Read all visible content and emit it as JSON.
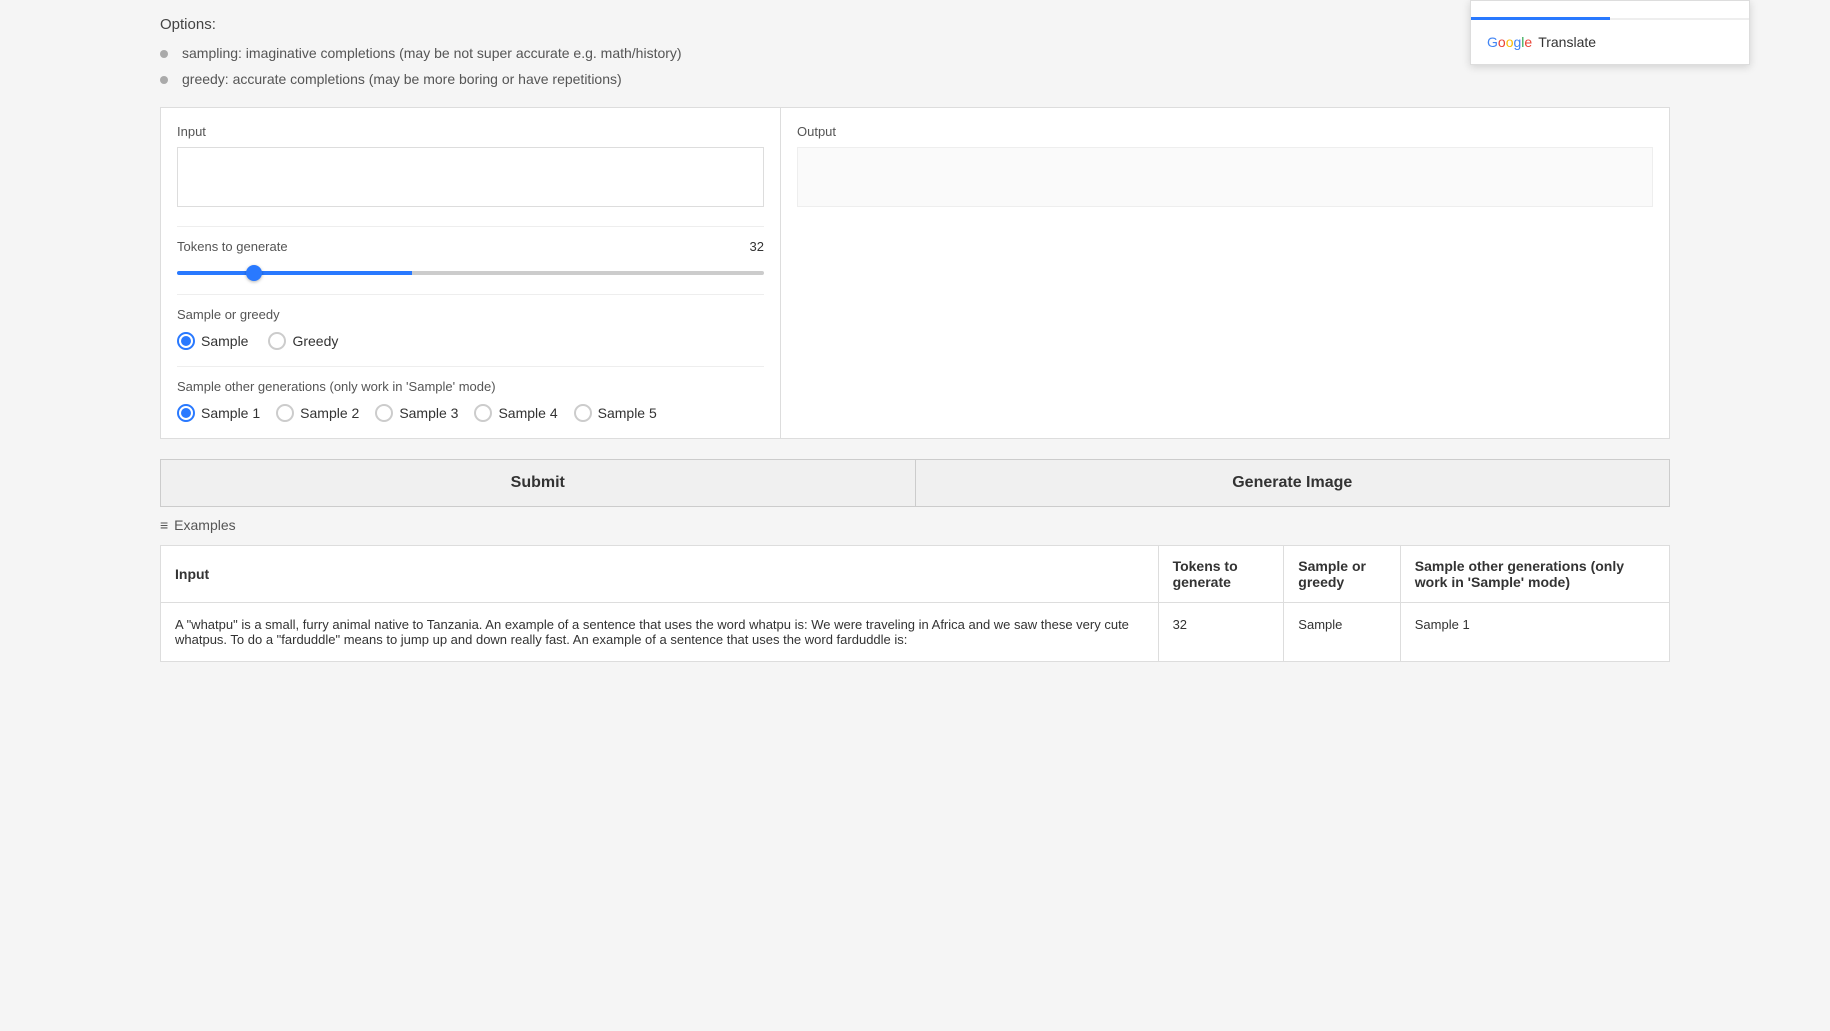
{
  "options": {
    "heading": "Options:",
    "bullets": [
      "sampling: imaginative completions (may be not super accurate e.g. math/history)",
      "greedy: accurate completions (may be more boring or have repetitions)"
    ]
  },
  "input_panel": {
    "label": "Input",
    "placeholder": ""
  },
  "output_panel": {
    "label": "Output"
  },
  "tokens": {
    "label": "Tokens to generate",
    "value": "32",
    "slider_percent": 40
  },
  "sample_greedy": {
    "label": "Sample or greedy",
    "options": [
      "Sample",
      "Greedy"
    ],
    "selected": "Sample"
  },
  "sample_generations": {
    "label": "Sample other generations (only work in 'Sample' mode)",
    "options": [
      "Sample 1",
      "Sample 2",
      "Sample 3",
      "Sample 4",
      "Sample 5"
    ],
    "selected": "Sample 1"
  },
  "buttons": {
    "submit": "Submit",
    "generate_image": "Generate Image"
  },
  "examples": {
    "heading": "Examples",
    "columns": [
      "Input",
      "Tokens to generate",
      "Sample or greedy",
      "Sample other generations (only work in 'Sample' mode)"
    ],
    "rows": [
      {
        "input": "A \"whatpu\" is a small, furry animal native to Tanzania. An example of a sentence that uses the word whatpu is: We were traveling in Africa and we saw these very cute whatpus. To do a \"farduddle\" means to jump up and down really fast. An example of a sentence that uses the word farduddle is:",
        "tokens": "32",
        "sample_greedy": "Sample",
        "sample_gen": "Sample 1"
      }
    ]
  },
  "google_translate": {
    "brand": "Google",
    "service": "Translate",
    "tab_active_label": "",
    "tab_inactive_label": ""
  }
}
